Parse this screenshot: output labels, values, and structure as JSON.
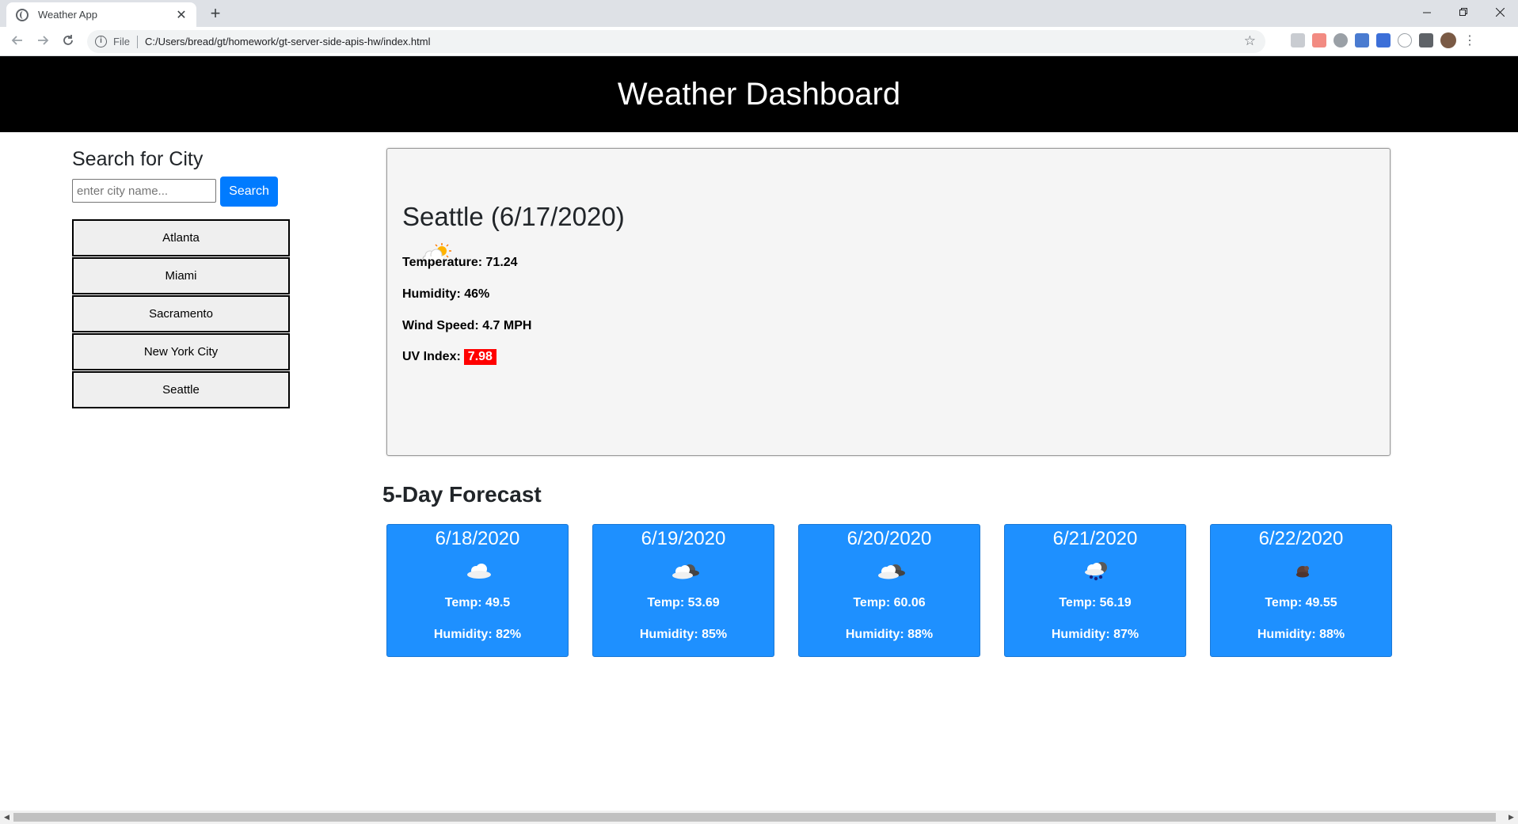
{
  "browser": {
    "tab_title": "Weather App",
    "tab_close": "✕",
    "new_tab": "+",
    "omnibox_scheme": "File",
    "url": "C:/Users/bread/gt/homework/gt-server-side-apis-hw/index.html"
  },
  "header": {
    "title": "Weather Dashboard"
  },
  "search": {
    "heading": "Search for City",
    "placeholder": "enter city name...",
    "button_label": "Search"
  },
  "cities": [
    "Atlanta",
    "Miami",
    "Sacramento",
    "New York City",
    "Seattle"
  ],
  "current": {
    "city_date": "Seattle (6/17/2020)",
    "icon": "partly-cloudy-sun-icon",
    "temperature_label": "Temperature:",
    "temperature": "71.24",
    "humidity_label": "Humidity:",
    "humidity": "46%",
    "wind_label": "Wind Speed:",
    "wind": "4.7 MPH",
    "uv_label": "UV Index:",
    "uv": "7.98",
    "uv_color": "#ff0000"
  },
  "forecast": {
    "heading": "5-Day Forecast",
    "card_color": "#1e90ff",
    "days": [
      {
        "date": "6/18/2020",
        "icon": "cloud-icon",
        "temp": "Temp: 49.5",
        "humidity": "Humidity: 82%"
      },
      {
        "date": "6/19/2020",
        "icon": "cloudy-night-icon",
        "temp": "Temp: 53.69",
        "humidity": "Humidity: 85%"
      },
      {
        "date": "6/20/2020",
        "icon": "cloudy-night-icon",
        "temp": "Temp: 60.06",
        "humidity": "Humidity: 88%"
      },
      {
        "date": "6/21/2020",
        "icon": "rain-cloud-icon",
        "temp": "Temp: 56.19",
        "humidity": "Humidity: 87%"
      },
      {
        "date": "6/22/2020",
        "icon": "dark-cloud-icon",
        "temp": "Temp: 49.55",
        "humidity": "Humidity: 88%"
      }
    ]
  }
}
